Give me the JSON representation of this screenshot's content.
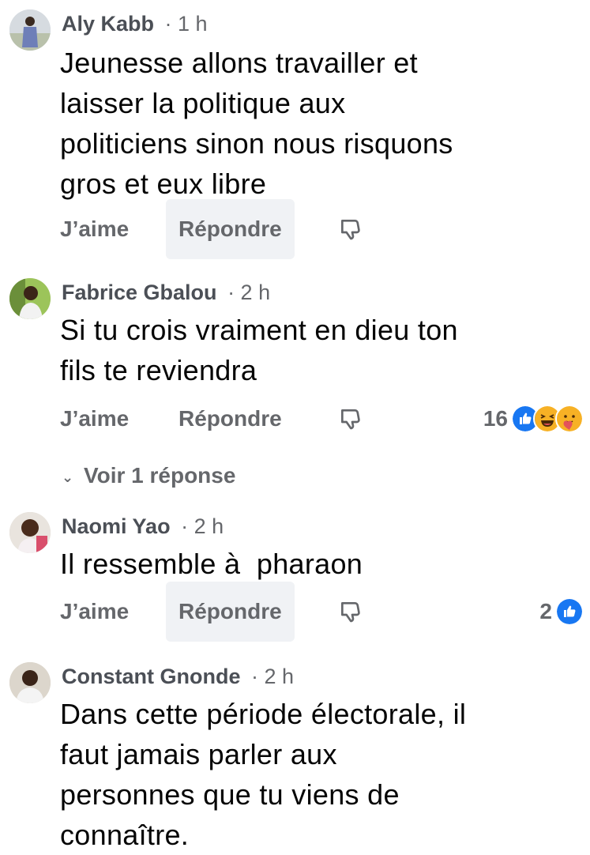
{
  "comments": [
    {
      "author": "Aly Kabb",
      "time": "· 1 h",
      "lines": [
        "Jeunesse allons travailler et",
        "laisser la politique aux",
        "politiciens sinon nous risquons",
        "gros et eux libre"
      ],
      "like_label": "J’aime",
      "reply_label": "Répondre",
      "reaction_count": ""
    },
    {
      "author": "Fabrice Gbalou",
      "time": "· 2 h",
      "lines": [
        "Si tu crois vraiment en dieu ton",
        "fils te reviendra"
      ],
      "like_label": "J’aime",
      "reply_label": "Répondre",
      "reaction_count": "16",
      "view_replies_label": "Voir 1 réponse"
    },
    {
      "author": "Naomi Yao",
      "time": "· 2 h",
      "lines": [
        "Il ressemble à  pharaon"
      ],
      "like_label": "J’aime",
      "reply_label": "Répondre",
      "reaction_count": "2"
    },
    {
      "author": "Constant Gnonde",
      "time": "· 2 h",
      "lines": [
        "Dans cette période électorale, il",
        "faut jamais parler aux",
        "personnes que tu viens de",
        "connaître."
      ]
    }
  ],
  "colors": {
    "name": "#4b4f56",
    "meta": "#65676b",
    "text": "#050505",
    "like_blue": "#1877f2",
    "haha_yellow": "#f7b125"
  },
  "icons": [
    "dislike-icon",
    "like-reaction-icon",
    "haha-reaction-icon",
    "care-reaction-icon",
    "chevron-down-icon"
  ]
}
